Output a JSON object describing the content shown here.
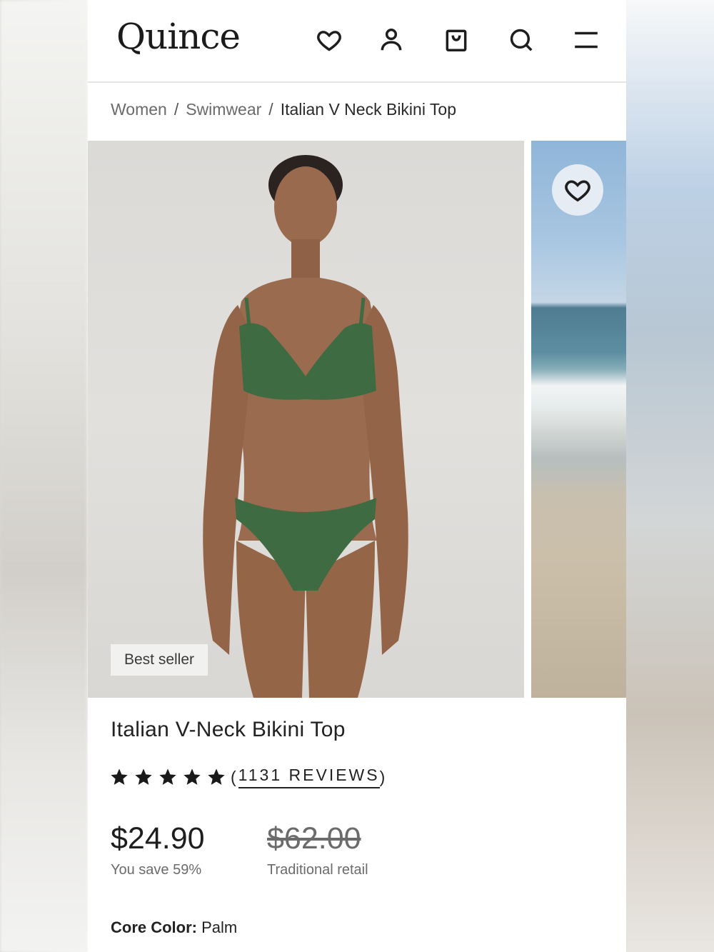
{
  "header": {
    "logo": "Quince",
    "icons": [
      "heart-icon",
      "user-icon",
      "shopping-bag-icon",
      "search-icon",
      "menu-icon"
    ]
  },
  "breadcrumb": {
    "items": [
      "Women",
      "Swimwear"
    ],
    "separator": "/",
    "current": "Italian V Neck Bikini Top"
  },
  "gallery": {
    "badge": "Best seller"
  },
  "product": {
    "title": "Italian V-Neck Bikini Top",
    "rating_stars": 5,
    "reviews_open": "(",
    "reviews_text": "1131 REVIEWS",
    "reviews_close": ")",
    "price": "$24.90",
    "savings": "You save 59%",
    "retail_price": "$62.00",
    "retail_label": "Traditional retail",
    "color_key": "Core Color:",
    "color_value": "Palm"
  },
  "colors": {
    "swimsuit": "#3e6b42",
    "text": "#1d1d1d",
    "muted": "#6b6b6b"
  }
}
